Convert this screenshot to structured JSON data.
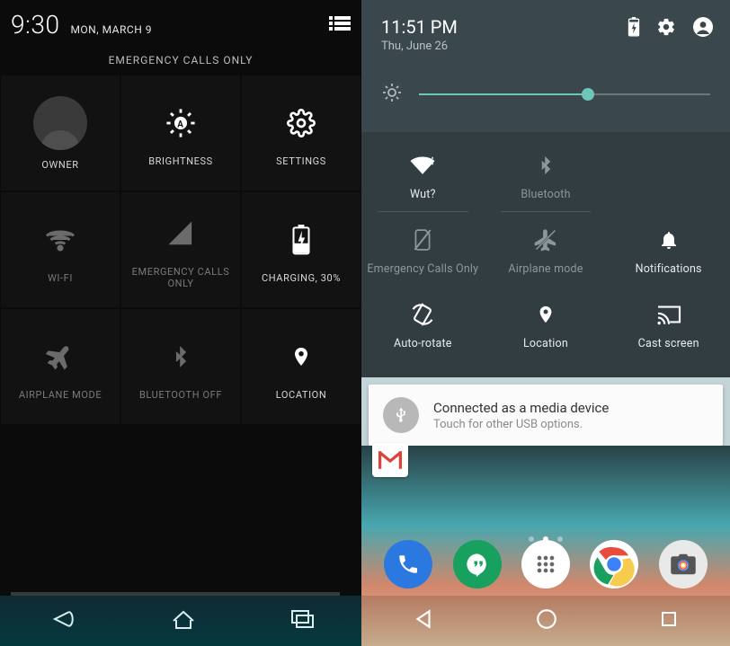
{
  "left": {
    "status": {
      "time": "9:30",
      "date": "MON, MARCH 9"
    },
    "emergency_label": "EMERGENCY CALLS ONLY",
    "tiles": {
      "owner": {
        "label": "OWNER"
      },
      "brightness": {
        "label": "BRIGHTNESS"
      },
      "settings": {
        "label": "SETTINGS"
      },
      "wifi": {
        "label": "WI-FI"
      },
      "cell": {
        "label": "EMERGENCY CALLS ONLY"
      },
      "battery": {
        "label": "CHARGING, 30%"
      },
      "airplane": {
        "label": "AIRPLANE MODE"
      },
      "bluetooth": {
        "label": "BLUETOOTH OFF"
      },
      "location": {
        "label": "LOCATION"
      }
    }
  },
  "right": {
    "status": {
      "time": "11:51 PM",
      "date": "Thu, June 26"
    },
    "brightness_pct": 58,
    "tiles": {
      "wifi": {
        "label": "Wut?"
      },
      "bluetooth": {
        "label": "Bluetooth"
      },
      "cell": {
        "label": "Emergency Calls Only"
      },
      "airplane": {
        "label": "Airplane mode"
      },
      "notif": {
        "label": "Notifications"
      },
      "rotate": {
        "label": "Auto-rotate"
      },
      "location": {
        "label": "Location"
      },
      "cast": {
        "label": "Cast screen"
      }
    },
    "notification": {
      "title": "Connected as a media device",
      "subtitle": "Touch for other USB options."
    }
  }
}
